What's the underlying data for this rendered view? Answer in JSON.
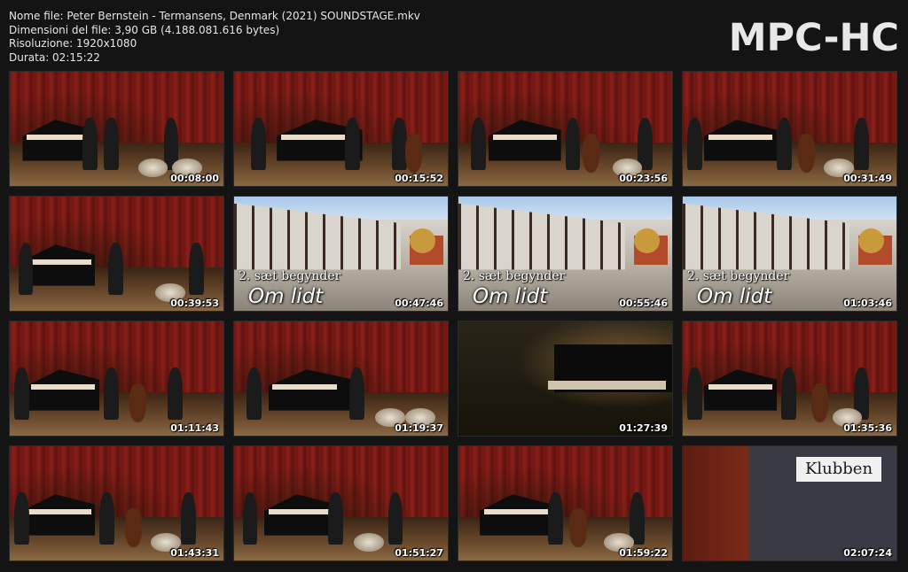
{
  "info": {
    "file_name": "Nome file: Peter Bernstein - Termansens, Denmark (2021) SOUNDSTAGE.mkv",
    "file_size": "Dimensioni del file: 3,90 GB (4.188.081.616 bytes)",
    "resolution": "Risoluzione: 1920x1080",
    "duration": "Durata: 02:15:22"
  },
  "logo": "MPC-HC",
  "thumbnails": [
    {
      "time": "00:08:00",
      "kind": "stage"
    },
    {
      "time": "00:15:52",
      "kind": "stage"
    },
    {
      "time": "00:23:56",
      "kind": "stage"
    },
    {
      "time": "00:31:49",
      "kind": "stage"
    },
    {
      "time": "00:39:53",
      "kind": "stage"
    },
    {
      "time": "00:47:46",
      "kind": "street"
    },
    {
      "time": "00:55:46",
      "kind": "street"
    },
    {
      "time": "01:03:46",
      "kind": "street"
    },
    {
      "time": "01:11:43",
      "kind": "stage"
    },
    {
      "time": "01:19:37",
      "kind": "stage"
    },
    {
      "time": "01:27:39",
      "kind": "dark"
    },
    {
      "time": "01:35:36",
      "kind": "stage"
    },
    {
      "time": "01:43:31",
      "kind": "stage"
    },
    {
      "time": "01:51:27",
      "kind": "stage"
    },
    {
      "time": "01:59:22",
      "kind": "stage"
    },
    {
      "time": "02:07:24",
      "kind": "window"
    }
  ],
  "overlay": {
    "subtitle_line1": "2. sæt begynder",
    "subtitle_line2": "Om lidt",
    "window_sign": "Klubben"
  }
}
